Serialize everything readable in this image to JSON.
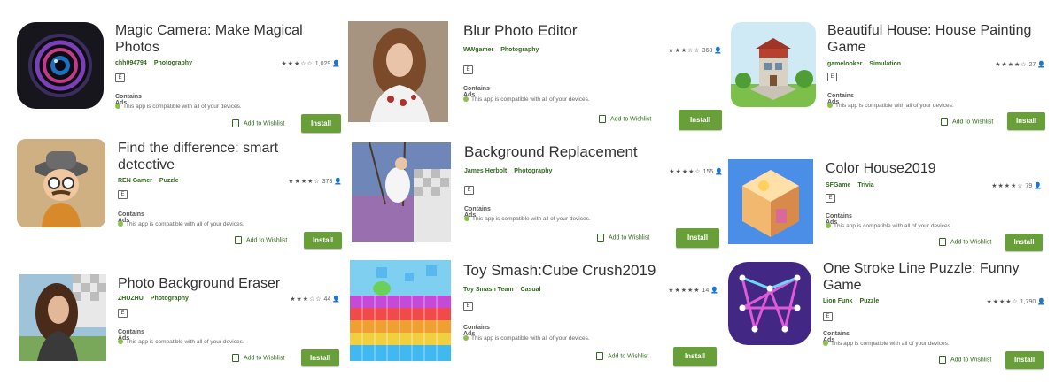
{
  "common": {
    "contains_ads": "Contains Ads",
    "compatibility": "This app is compatible with all of your devices.",
    "wishlist_label": "Add to Wishlist",
    "install_label": "Install",
    "content_rating": "E"
  },
  "apps": [
    {
      "title": "Magic Camera: Make Magical Photos",
      "developer": "chh094794",
      "category": "Photography",
      "stars": "★★★☆☆",
      "rating_count": "1,029"
    },
    {
      "title": "Blur Photo Editor",
      "developer": "WWgamer",
      "category": "Photography",
      "stars": "★★★☆☆",
      "rating_count": "368"
    },
    {
      "title": "Beautiful House: House Painting Game",
      "developer": "gamelooker",
      "category": "Simulation",
      "stars": "★★★★☆",
      "rating_count": "27"
    },
    {
      "title": "Find the difference: smart detective",
      "developer": "REN Gamer",
      "category": "Puzzle",
      "stars": "★★★★☆",
      "rating_count": "373"
    },
    {
      "title": "Background Replacement",
      "developer": "James Herbolt",
      "category": "Photography",
      "stars": "★★★★☆",
      "rating_count": "155"
    },
    {
      "title": "Color House2019",
      "developer": "SFGame",
      "category": "Trivia",
      "stars": "★★★★☆",
      "rating_count": "79"
    },
    {
      "title": "Photo Background Eraser",
      "developer": "ZHUZHU",
      "category": "Photography",
      "stars": "★★★☆☆",
      "rating_count": "44"
    },
    {
      "title": "Toy Smash:Cube Crush2019",
      "developer": "Toy Smash Team",
      "category": "Casual",
      "stars": "★★★★★",
      "rating_count": "14"
    },
    {
      "title": "One Stroke Line Puzzle: Funny Game",
      "developer": "Lion Funk",
      "category": "Puzzle",
      "stars": "★★★★☆",
      "rating_count": "1,790"
    }
  ]
}
